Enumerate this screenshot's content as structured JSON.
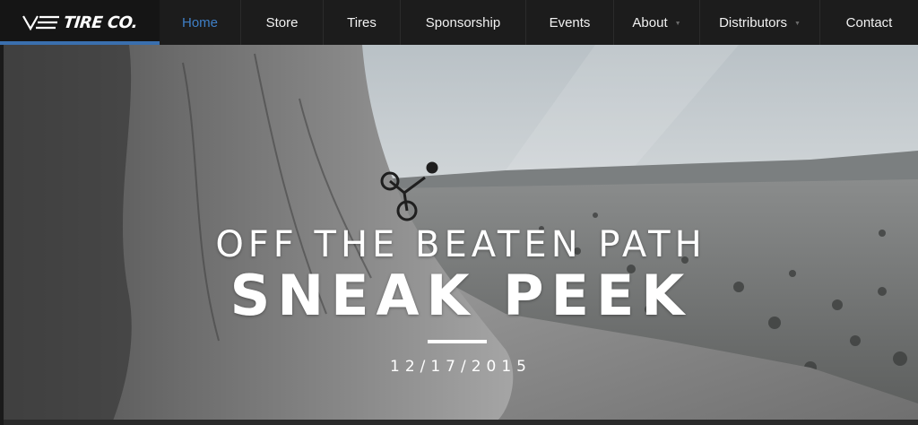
{
  "brand": {
    "name": "TIRE CO.",
    "logo_icon": "vee-logo-icon",
    "accent_color": "#3a6fae"
  },
  "nav": {
    "items": [
      {
        "label": "Home",
        "active": true,
        "has_dropdown": false
      },
      {
        "label": "Store",
        "active": false,
        "has_dropdown": false
      },
      {
        "label": "Tires",
        "active": false,
        "has_dropdown": false
      },
      {
        "label": "Sponsorship",
        "active": false,
        "has_dropdown": false
      },
      {
        "label": "Events",
        "active": false,
        "has_dropdown": false
      },
      {
        "label": "About",
        "active": false,
        "has_dropdown": true
      },
      {
        "label": "Distributors",
        "active": false,
        "has_dropdown": true
      },
      {
        "label": "Contact",
        "active": false,
        "has_dropdown": false
      }
    ],
    "active_color": "#3f7fc6",
    "dropdown_icon": "caret-down-icon"
  },
  "hero": {
    "headline_line1": "OFF THE BEATEN PATH",
    "headline_line2": "SNEAK PEEK",
    "date": "12/17/2015"
  }
}
